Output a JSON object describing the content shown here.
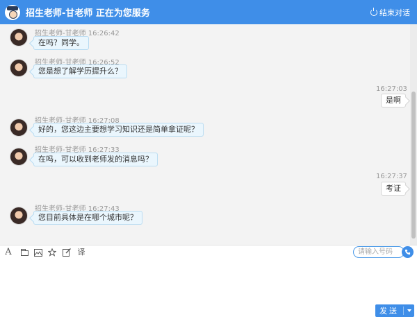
{
  "header": {
    "title": "招生老师-甘老师 正在为您服务",
    "end_label": "结束对话",
    "logo_icon": "teacher-avatar-logo",
    "end_icon": "power-icon"
  },
  "messages": [
    {
      "side": "left",
      "sender": "招生老师-甘老师",
      "time": "16:26:42",
      "text": "在吗？同学。"
    },
    {
      "side": "left",
      "sender": "招生老师-甘老师",
      "time": "16:26:52",
      "text": "您是想了解学历提升么？"
    },
    {
      "side": "right",
      "time": "16:27:03",
      "text": "是啊"
    },
    {
      "side": "left",
      "sender": "招生老师-甘老师",
      "time": "16:27:08",
      "text": "好的，您这边主要想学习知识还是简单拿证呢？"
    },
    {
      "side": "left",
      "sender": "招生老师-甘老师",
      "time": "16:27:33",
      "text": "在吗，可以收到老师发的消息吗？"
    },
    {
      "side": "right",
      "time": "16:27:37",
      "text": "考证"
    },
    {
      "side": "left",
      "sender": "招生老师-甘老师",
      "time": "16:27:43",
      "text": "您目前具体是在哪个城市呢？"
    }
  ],
  "toolbar": {
    "tools": [
      "font-icon",
      "folder-icon",
      "image-icon",
      "star-icon",
      "edit-icon",
      "translate-icon"
    ],
    "font_glyph": "A",
    "translate_glyph": "译",
    "phone_placeholder": "请输入号码",
    "phone_icon": "phone-icon"
  },
  "composer": {
    "value": "",
    "send_label": "发送"
  },
  "colors": {
    "accent": "#3f8ee8",
    "bubble_bg": "#eaf6fd",
    "bubble_border": "#b9dcf2"
  }
}
